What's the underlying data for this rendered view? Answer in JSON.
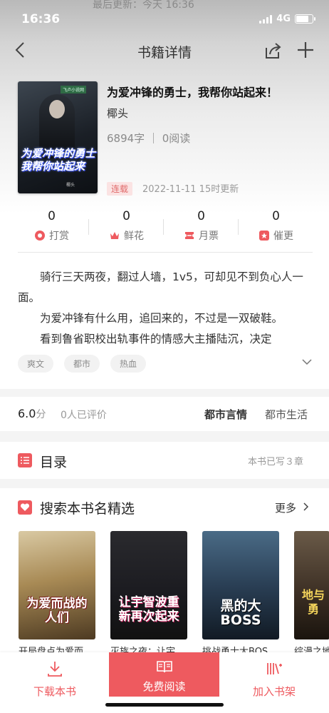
{
  "status_bar": {
    "time": "16:36",
    "network": "4G"
  },
  "ghost_banner": "最后更新：今天 16:36",
  "nav": {
    "title": "书籍详情"
  },
  "book": {
    "cover_title": "为爱冲锋的勇士我帮你站起来",
    "cover_author": "椰头",
    "cover_tag": "飞卢小说网",
    "title": "为爱冲锋的勇士，我帮你站起来！",
    "author": "椰头",
    "stats": "6894字 ｜ 0阅读",
    "status_badge": "连载",
    "updated": "2022-11-11 15时更新"
  },
  "metrics": [
    {
      "value": "0",
      "label": "打赏",
      "icon": "reward-icon"
    },
    {
      "value": "0",
      "label": "鲜花",
      "icon": "flower-icon"
    },
    {
      "value": "0",
      "label": "月票",
      "icon": "monthly-ticket-icon"
    },
    {
      "value": "0",
      "label": "催更",
      "icon": "urge-update-icon"
    }
  ],
  "intro": {
    "p1": "骑行三天两夜，翻过人墙，1v5，可却见不到负心人一面。",
    "p2": "为爱冲锋有什么用，追回来的，不过是一双破鞋。",
    "p3": "看到鲁省职校出轨事件的情感大主播陆沉，决定"
  },
  "tags": [
    "爽文",
    "都市",
    "热血"
  ],
  "rating": {
    "score": "6.0",
    "unit": "分",
    "count": "0人已评价",
    "category1": "都市言情",
    "category2": "都市生活"
  },
  "toc": {
    "label": "目录",
    "info": "本书已写３章"
  },
  "picks": {
    "label": "搜索本书名精选",
    "more": "更多",
    "items": [
      {
        "title": "开局盘点为爱而",
        "cover_text": "为爱而战的人们"
      },
      {
        "title": "灭族之夜：让宇",
        "cover_text": "让宇智波重新再次起来"
      },
      {
        "title": "挑战勇士大BOS",
        "cover_text": "黑的大BOSS"
      },
      {
        "title": "综漫之地",
        "cover_text": "地与勇"
      }
    ]
  },
  "bottom": {
    "download": "下载本书",
    "read": "免费阅读",
    "shelf": "加入书架"
  },
  "colors": {
    "accent": "#ee5a5f",
    "badge_bg": "#fbe3e3"
  }
}
